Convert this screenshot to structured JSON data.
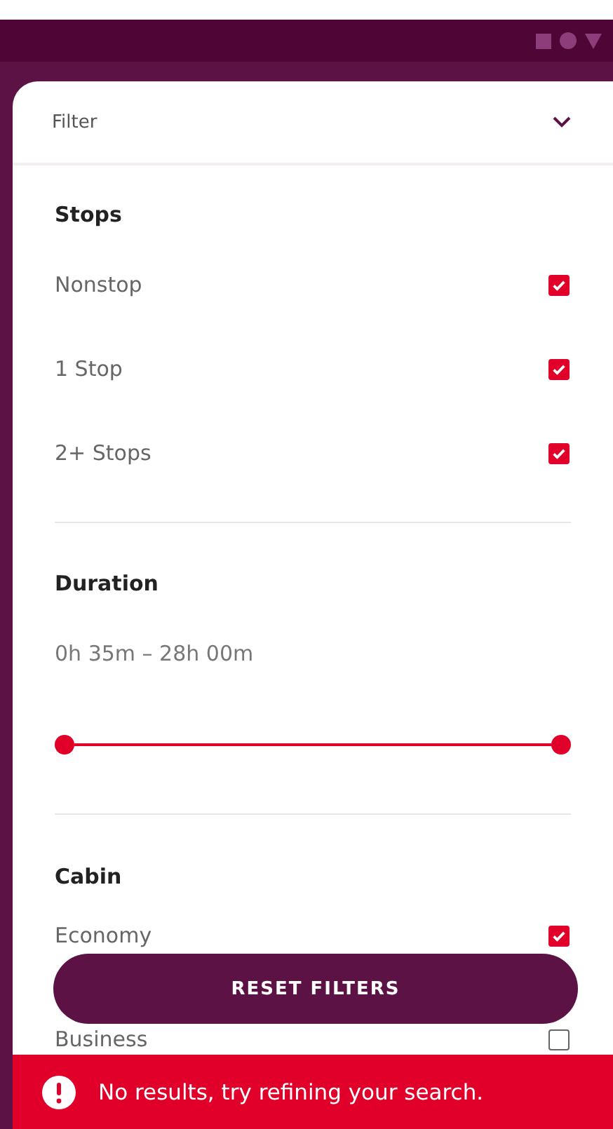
{
  "sheet": {
    "title": "Filter"
  },
  "stops": {
    "heading": "Stops",
    "options": [
      {
        "label": "Nonstop",
        "checked": true
      },
      {
        "label": "1 Stop",
        "checked": true
      },
      {
        "label": "2+ Stops",
        "checked": true
      }
    ]
  },
  "duration": {
    "heading": "Duration",
    "reading": "0h 35m – 28h 00m",
    "thumbs": [
      {
        "level": 0
      },
      {
        "level": 1
      }
    ]
  },
  "cabin": {
    "heading": "Cabin",
    "options": [
      {
        "label": "Economy",
        "checked": true
      },
      {
        "label": "Business",
        "checked": false
      }
    ]
  },
  "reset_button": "RESET FILTERS",
  "toast": {
    "message": "No results, try refining your search."
  }
}
